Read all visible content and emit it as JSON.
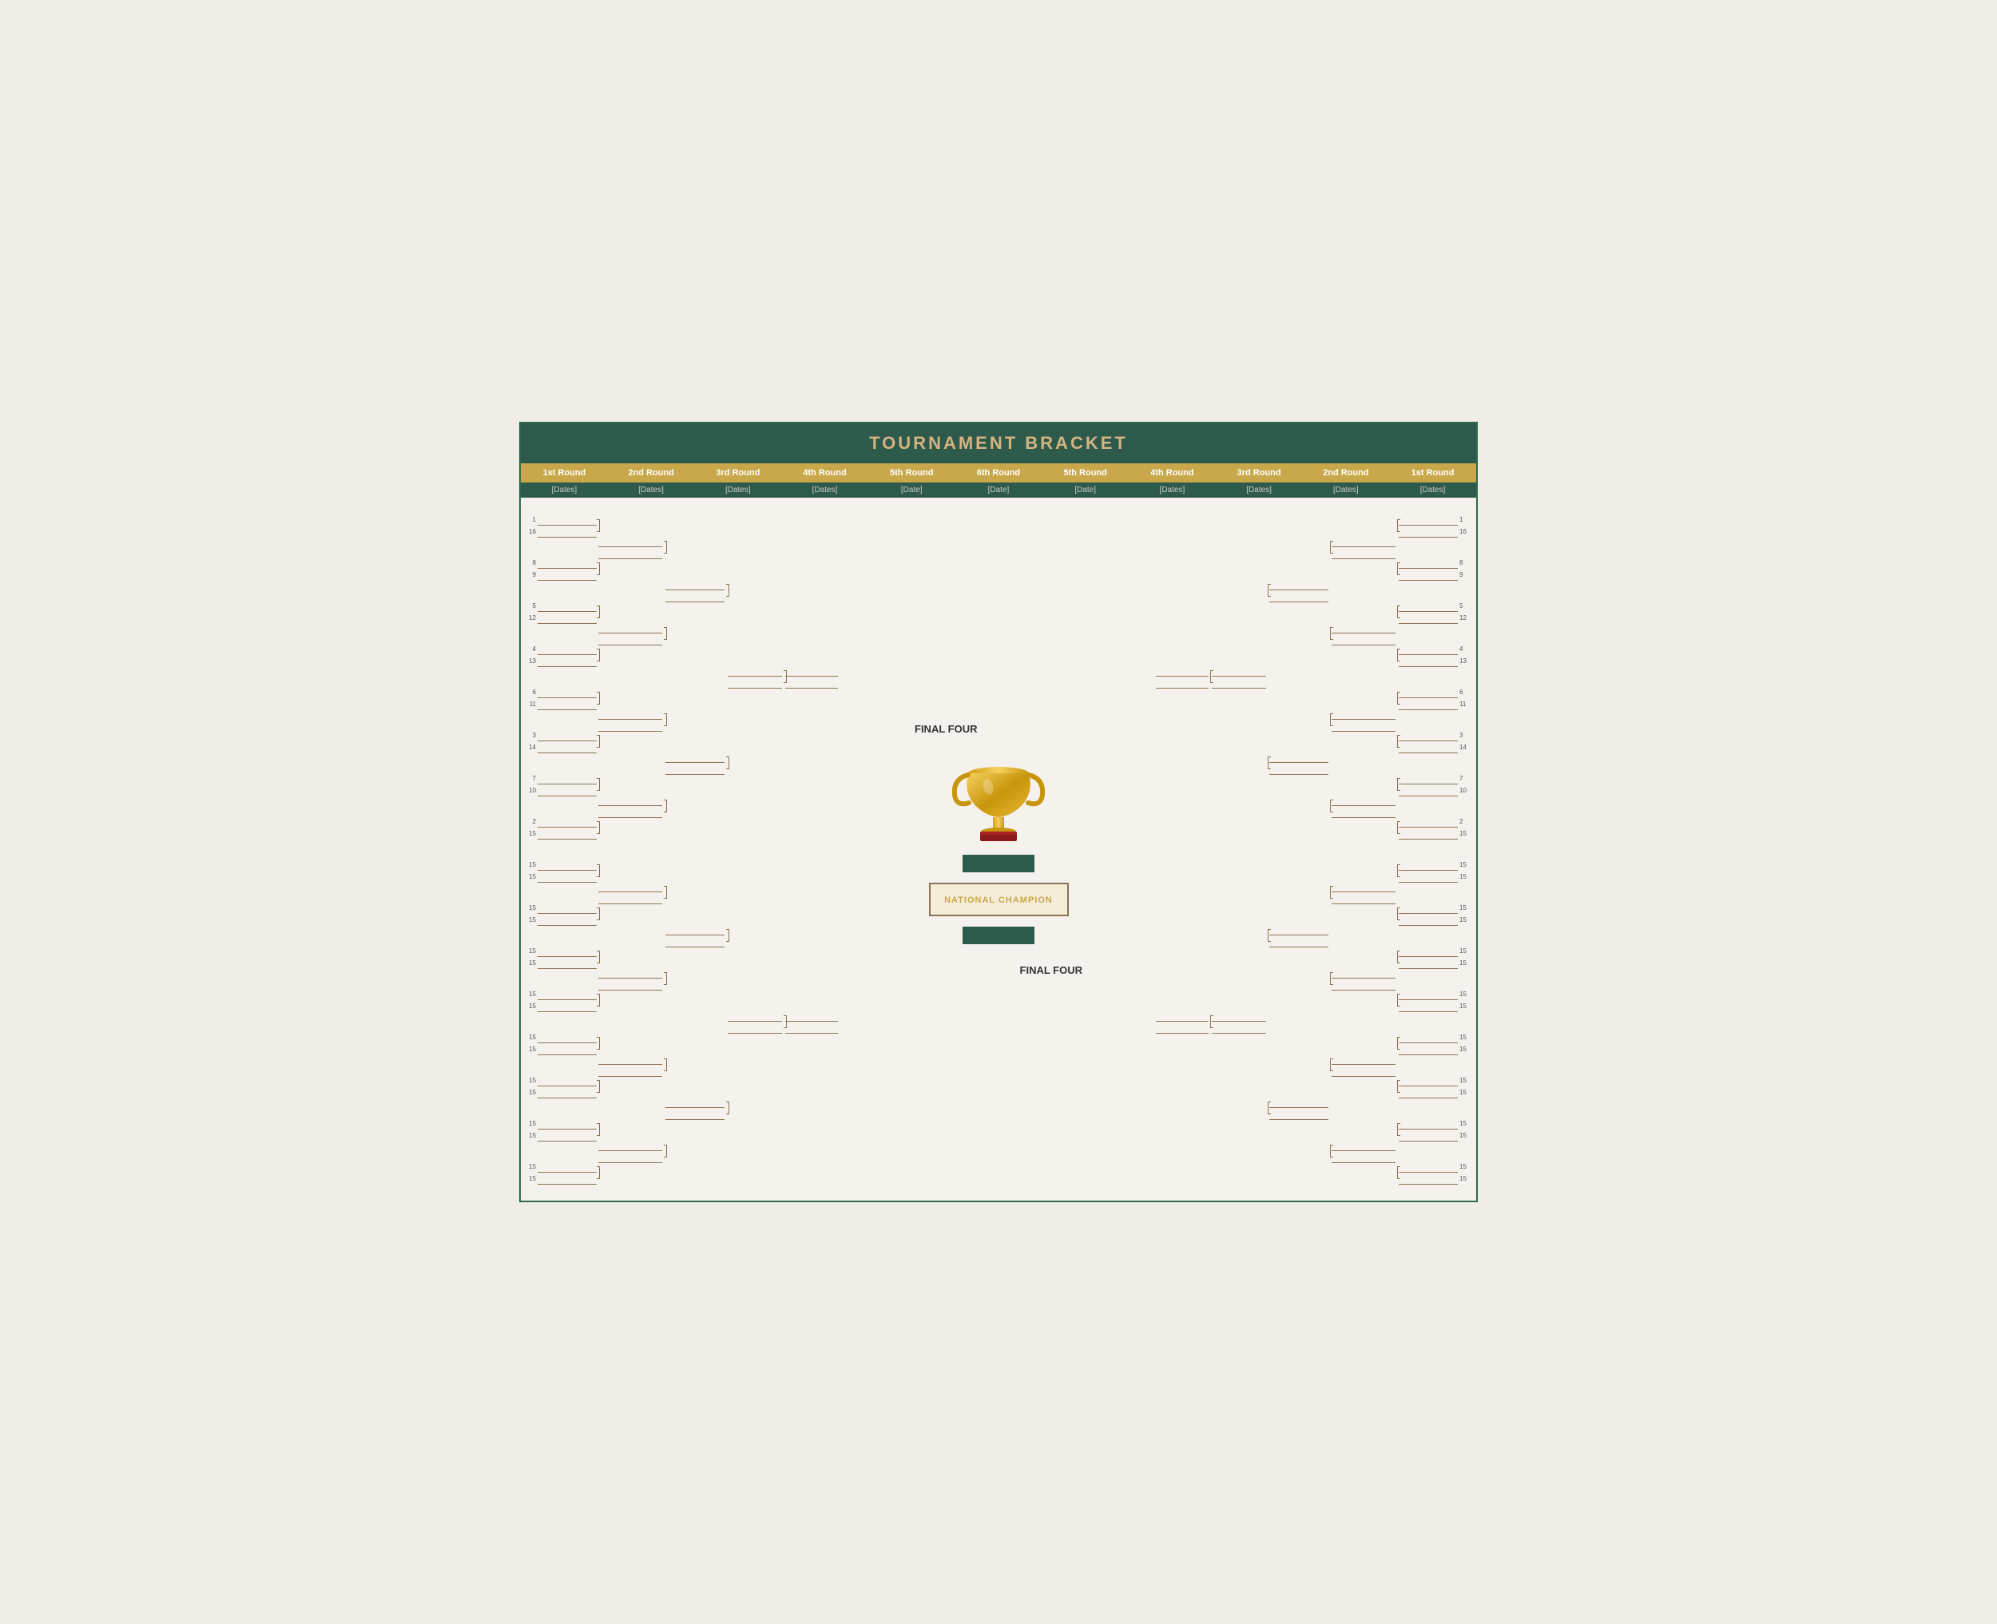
{
  "title": "TOURNAMENT BRACKET",
  "rounds": {
    "left": [
      "1st Round",
      "2nd Round",
      "3rd Round",
      "4th Round",
      "5th Round",
      "6th Round"
    ],
    "right": [
      "5th Round",
      "4th Round",
      "3rd Round",
      "2nd Round",
      "1st Round"
    ]
  },
  "dates": {
    "left": [
      "[Dates]",
      "[Dates]",
      "[Dates]",
      "[Dates]",
      "[Date]",
      "[Date]"
    ],
    "right": [
      "[Date]",
      "[Dates]",
      "[Dates]",
      "[Dates]",
      "[Dates]"
    ]
  },
  "center": {
    "finalFourLeft": "FINAL FOUR",
    "nationalChampion": "NATIONAL CHAMPION",
    "finalFourRight": "FINAL FOUR"
  },
  "seeds_top": [
    1,
    16,
    8,
    9,
    5,
    12,
    4,
    13,
    6,
    11,
    3,
    14,
    7,
    10,
    2,
    15
  ],
  "seeds_bottom": [
    1,
    16,
    8,
    9,
    5,
    12,
    4,
    13,
    6,
    11,
    3,
    14,
    7,
    10,
    2,
    15
  ]
}
